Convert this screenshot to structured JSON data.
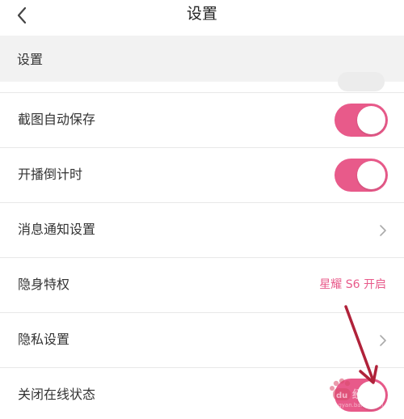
{
  "nav": {
    "title": "设置",
    "back_icon": "chevron-left-icon"
  },
  "section": {
    "header": "设置"
  },
  "rows": [
    {
      "label": "截图自动保存",
      "control": "toggle",
      "on": true
    },
    {
      "label": "开播倒计时",
      "control": "toggle",
      "on": true
    },
    {
      "label": "消息通知设置",
      "control": "chevron",
      "icon": "chevron-right-icon"
    },
    {
      "label": "隐身特权",
      "control": "value",
      "value": "星耀 S6 开启"
    },
    {
      "label": "隐私设置",
      "control": "chevron",
      "icon": "chevron-right-icon"
    },
    {
      "label": "关闭在线状态",
      "control": "toggle",
      "on": true
    }
  ],
  "colors": {
    "accent": "#e85a8a",
    "background": "#ffffff",
    "section_bg": "#f2f2f2",
    "divider": "#e8e8e8",
    "annotation_arrow": "#b0223a"
  },
  "watermark": {
    "text": "Baidu经验"
  }
}
